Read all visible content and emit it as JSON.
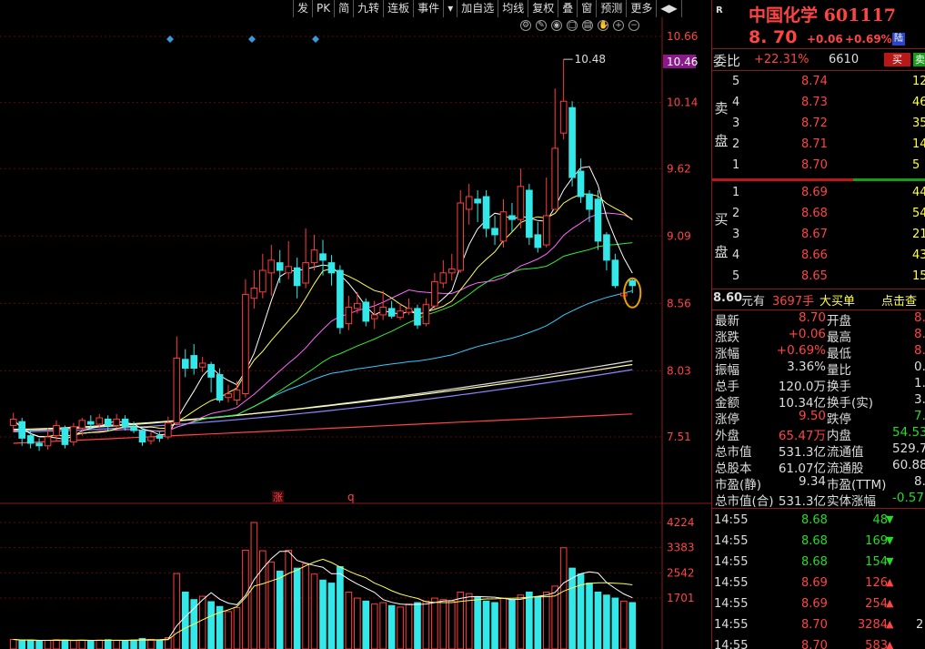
{
  "toolbar": {
    "items": [
      "发",
      "PK",
      "简",
      "九转",
      "连板",
      "事件",
      "▾",
      "加自选",
      "均线",
      "复权",
      "叠",
      "窗",
      "预测",
      "更多",
      "◀▶"
    ]
  },
  "chart_data": {
    "type": "candlestick",
    "price_axis_labels": [
      "10.66",
      "10.46",
      "10.14",
      "9.62",
      "9.09",
      "8.56",
      "8.03",
      "7.51"
    ],
    "current_price_tag": "10.46",
    "high_marker_label": "10.48",
    "volume_axis_labels": [
      "4224",
      "3383",
      "2542",
      "1701"
    ],
    "event_markers": [
      "涨",
      "q"
    ],
    "candles": [
      {
        "o": 7.6,
        "c": 7.65,
        "h": 7.7,
        "l": 7.55
      },
      {
        "o": 7.63,
        "c": 7.5,
        "h": 7.66,
        "l": 7.44
      },
      {
        "o": 7.52,
        "c": 7.46,
        "h": 7.57,
        "l": 7.42
      },
      {
        "o": 7.46,
        "c": 7.44,
        "h": 7.5,
        "l": 7.4
      },
      {
        "o": 7.44,
        "c": 7.51,
        "h": 7.58,
        "l": 7.41
      },
      {
        "o": 7.52,
        "c": 7.6,
        "h": 7.64,
        "l": 7.48
      },
      {
        "o": 7.58,
        "c": 7.45,
        "h": 7.6,
        "l": 7.42
      },
      {
        "o": 7.47,
        "c": 7.59,
        "h": 7.62,
        "l": 7.44
      },
      {
        "o": 7.58,
        "c": 7.64,
        "h": 7.66,
        "l": 7.52
      },
      {
        "o": 7.63,
        "c": 7.61,
        "h": 7.68,
        "l": 7.57
      },
      {
        "o": 7.61,
        "c": 7.66,
        "h": 7.69,
        "l": 7.58
      },
      {
        "o": 7.65,
        "c": 7.6,
        "h": 7.68,
        "l": 7.56
      },
      {
        "o": 7.6,
        "c": 7.65,
        "h": 7.69,
        "l": 7.58
      },
      {
        "o": 7.65,
        "c": 7.59,
        "h": 7.68,
        "l": 7.56
      },
      {
        "o": 7.59,
        "c": 7.56,
        "h": 7.63,
        "l": 7.54
      },
      {
        "o": 7.56,
        "c": 7.47,
        "h": 7.58,
        "l": 7.44
      },
      {
        "o": 7.48,
        "c": 7.51,
        "h": 7.55,
        "l": 7.45
      },
      {
        "o": 7.52,
        "c": 7.5,
        "h": 7.55,
        "l": 7.47
      },
      {
        "o": 7.51,
        "c": 7.62,
        "h": 7.67,
        "l": 7.49
      },
      {
        "o": 7.62,
        "c": 8.13,
        "h": 8.3,
        "l": 7.6
      },
      {
        "o": 8.12,
        "c": 8.05,
        "h": 8.2,
        "l": 7.98
      },
      {
        "o": 8.15,
        "c": 8.05,
        "h": 8.24,
        "l": 8.0
      },
      {
        "o": 8.06,
        "c": 8.09,
        "h": 8.14,
        "l": 8.02
      },
      {
        "o": 8.08,
        "c": 7.98,
        "h": 8.1,
        "l": 7.86
      },
      {
        "o": 8.0,
        "c": 7.8,
        "h": 8.05,
        "l": 7.78
      },
      {
        "o": 7.82,
        "c": 7.85,
        "h": 7.92,
        "l": 7.78
      },
      {
        "o": 7.8,
        "c": 7.88,
        "h": 7.95,
        "l": 7.76
      },
      {
        "o": 7.85,
        "c": 8.63,
        "h": 8.75,
        "l": 7.82
      },
      {
        "o": 8.6,
        "c": 8.68,
        "h": 8.82,
        "l": 8.52
      },
      {
        "o": 8.65,
        "c": 8.82,
        "h": 8.95,
        "l": 8.6
      },
      {
        "o": 8.8,
        "c": 8.9,
        "h": 9.02,
        "l": 8.62
      },
      {
        "o": 8.88,
        "c": 8.82,
        "h": 8.98,
        "l": 8.72
      },
      {
        "o": 8.8,
        "c": 8.85,
        "h": 9.05,
        "l": 8.75
      },
      {
        "o": 8.84,
        "c": 8.7,
        "h": 8.92,
        "l": 8.6
      },
      {
        "o": 8.72,
        "c": 8.88,
        "h": 9.15,
        "l": 8.68
      },
      {
        "o": 8.88,
        "c": 8.98,
        "h": 9.1,
        "l": 8.82
      },
      {
        "o": 8.95,
        "c": 8.9,
        "h": 9.06,
        "l": 8.78
      },
      {
        "o": 8.88,
        "c": 8.8,
        "h": 8.94,
        "l": 8.7
      },
      {
        "o": 8.82,
        "c": 8.37,
        "h": 8.86,
        "l": 8.32
      },
      {
        "o": 8.4,
        "c": 8.53,
        "h": 8.62,
        "l": 8.35
      },
      {
        "o": 8.52,
        "c": 8.56,
        "h": 8.65,
        "l": 8.48
      },
      {
        "o": 8.57,
        "c": 8.42,
        "h": 8.6,
        "l": 8.38
      },
      {
        "o": 8.44,
        "c": 8.47,
        "h": 8.58,
        "l": 8.36
      },
      {
        "o": 8.47,
        "c": 8.53,
        "h": 8.66,
        "l": 8.43
      },
      {
        "o": 8.52,
        "c": 8.46,
        "h": 8.58,
        "l": 8.44
      },
      {
        "o": 8.45,
        "c": 8.5,
        "h": 8.56,
        "l": 8.43
      },
      {
        "o": 8.49,
        "c": 8.52,
        "h": 8.6,
        "l": 8.47
      },
      {
        "o": 8.52,
        "c": 8.39,
        "h": 8.55,
        "l": 8.36
      },
      {
        "o": 8.4,
        "c": 8.55,
        "h": 8.6,
        "l": 8.38
      },
      {
        "o": 8.54,
        "c": 8.73,
        "h": 8.8,
        "l": 8.52
      },
      {
        "o": 8.72,
        "c": 8.8,
        "h": 8.9,
        "l": 8.68
      },
      {
        "o": 8.8,
        "c": 8.83,
        "h": 8.95,
        "l": 8.74
      },
      {
        "o": 8.82,
        "c": 9.35,
        "h": 9.45,
        "l": 8.8
      },
      {
        "o": 9.3,
        "c": 9.4,
        "h": 9.5,
        "l": 9.18
      },
      {
        "o": 9.38,
        "c": 9.35,
        "h": 9.45,
        "l": 9.2
      },
      {
        "o": 9.4,
        "c": 9.15,
        "h": 9.45,
        "l": 9.08
      },
      {
        "o": 9.15,
        "c": 9.1,
        "h": 9.25,
        "l": 9.02
      },
      {
        "o": 9.05,
        "c": 9.28,
        "h": 9.38,
        "l": 9.0
      },
      {
        "o": 9.25,
        "c": 9.22,
        "h": 9.35,
        "l": 9.12
      },
      {
        "o": 9.22,
        "c": 9.48,
        "h": 9.62,
        "l": 9.15
      },
      {
        "o": 9.45,
        "c": 9.08,
        "h": 9.5,
        "l": 9.02
      },
      {
        "o": 9.1,
        "c": 9.0,
        "h": 9.2,
        "l": 8.96
      },
      {
        "o": 9.02,
        "c": 9.25,
        "h": 9.55,
        "l": 9.0
      },
      {
        "o": 9.3,
        "c": 9.78,
        "h": 10.25,
        "l": 9.7
      },
      {
        "o": 9.9,
        "c": 10.15,
        "h": 10.48,
        "l": 9.85
      },
      {
        "o": 10.1,
        "c": 9.55,
        "h": 10.15,
        "l": 9.48
      },
      {
        "o": 9.6,
        "c": 9.4,
        "h": 9.7,
        "l": 9.35
      },
      {
        "o": 9.42,
        "c": 9.3,
        "h": 9.45,
        "l": 9.2
      },
      {
        "o": 9.38,
        "c": 9.05,
        "h": 9.45,
        "l": 8.98
      },
      {
        "o": 9.1,
        "c": 8.9,
        "h": 9.12,
        "l": 8.82
      },
      {
        "o": 8.9,
        "c": 8.7,
        "h": 8.95,
        "l": 8.68
      },
      {
        "o": 8.62,
        "c": 8.64,
        "h": 8.68,
        "l": 8.6
      },
      {
        "o": 8.74,
        "c": 8.7,
        "h": 8.75,
        "l": 8.64
      }
    ],
    "volumes": [
      320,
      280,
      300,
      260,
      290,
      310,
      300,
      280,
      290,
      270,
      300,
      310,
      290,
      280,
      300,
      350,
      320,
      300,
      380,
      2520,
      1900,
      1650,
      1760,
      1580,
      1420,
      1250,
      1380,
      3300,
      4224,
      3280,
      2900,
      2600,
      3300,
      2700,
      2850,
      2500,
      2300,
      2200,
      2750,
      1900,
      1700,
      1600,
      1500,
      1550,
      1450,
      1400,
      1500,
      1550,
      1600,
      1700,
      1650,
      1600,
      1900,
      1850,
      1750,
      1600,
      1550,
      1700,
      1650,
      1800,
      1900,
      1750,
      1900,
      2100,
      3380,
      2700,
      2500,
      2200,
      1900,
      1800,
      1700,
      1600,
      1550
    ]
  },
  "panel": {
    "r_label": "R",
    "stock_name": "中国化学",
    "stock_code": "601117",
    "price": "8. 70",
    "change": "+0.06",
    "change_pct": "+0.69%",
    "exchange_badge": "陆",
    "wb_label": "委比",
    "wb_value": "+22.31%",
    "wb_diff": "6610",
    "buy_btn": "买",
    "sell_btn": "卖",
    "sell_side_label_1": "卖",
    "sell_side_label_2": "盘",
    "buy_side_label_1": "买",
    "buy_side_label_2": "盘",
    "asks": [
      {
        "level": "5",
        "price": "8.74",
        "vol": "12"
      },
      {
        "level": "4",
        "price": "8.73",
        "vol": "46"
      },
      {
        "level": "3",
        "price": "8.72",
        "vol": "35"
      },
      {
        "level": "2",
        "price": "8.71",
        "vol": "14"
      },
      {
        "level": "1",
        "price": "8.70",
        "vol": "5"
      }
    ],
    "bids": [
      {
        "level": "1",
        "price": "8.69",
        "vol": "44"
      },
      {
        "level": "2",
        "price": "8.68",
        "vol": "54"
      },
      {
        "level": "3",
        "price": "8.67",
        "vol": "21"
      },
      {
        "level": "4",
        "price": "8.66",
        "vol": "43"
      },
      {
        "level": "5",
        "price": "8.65",
        "vol": "15"
      }
    ],
    "big_order": {
      "price": "8.60",
      "unit": "元有",
      "vol": "3697手",
      "label": "大买单",
      "link": "点击查"
    },
    "stats": [
      {
        "l1": "最新",
        "v1": "8.70",
        "c1": "red",
        "l2": "开盘",
        "v2": "8.",
        "c2": "red"
      },
      {
        "l1": "涨跌",
        "v1": "+0.06",
        "c1": "red",
        "l2": "最高",
        "v2": "8.",
        "c2": "red"
      },
      {
        "l1": "涨幅",
        "v1": "+0.69%",
        "c1": "red",
        "l2": "最低",
        "v2": "8.",
        "c2": "red"
      },
      {
        "l1": "振幅",
        "v1": "3.36%",
        "c1": "white",
        "l2": "量比",
        "v2": "0.",
        "c2": "white"
      },
      {
        "l1": "总手",
        "v1": "120.0万",
        "c1": "white",
        "l2": "换手",
        "v2": "1.9",
        "c2": "white"
      },
      {
        "l1": "金额",
        "v1": "10.34亿",
        "c1": "white",
        "l2": "换手(实)",
        "v2": "3.5",
        "c2": "white"
      },
      {
        "l1": "涨停",
        "v1": "9.50",
        "c1": "red",
        "l2": "跌停",
        "v2": "7.",
        "c2": "grn"
      },
      {
        "l1": "外盘",
        "v1": "65.47万",
        "c1": "red",
        "l2": "内盘",
        "v2": "54.53",
        "c2": "grn"
      },
      {
        "l1": "总市值",
        "v1": "531.3亿",
        "c1": "white",
        "l2": "流通值",
        "v2": "529.7",
        "c2": "white"
      },
      {
        "l1": "总股本",
        "v1": "61.07亿",
        "c1": "white",
        "l2": "流通股",
        "v2": "60.88",
        "c2": "white"
      },
      {
        "l1": "市盈(静)",
        "v1": "9.34",
        "c1": "white",
        "l2": "市盈(TTM)",
        "v2": "8.",
        "c2": "white"
      },
      {
        "l1": "总市值(合)",
        "v1": "531.3亿",
        "c1": "white",
        "l2": "实体涨幅",
        "v2": "-0.57",
        "c2": "grn"
      }
    ],
    "ticks": [
      {
        "time": "14:55",
        "price": "8.68",
        "price_color": "grn",
        "vol": "48",
        "dir": "down"
      },
      {
        "time": "14:55",
        "price": "8.68",
        "price_color": "grn",
        "vol": "169",
        "dir": "down"
      },
      {
        "time": "14:55",
        "price": "8.68",
        "price_color": "grn",
        "vol": "154",
        "dir": "down"
      },
      {
        "time": "14:55",
        "price": "8.69",
        "price_color": "red",
        "vol": "126",
        "dir": "up"
      },
      {
        "time": "14:55",
        "price": "8.69",
        "price_color": "red",
        "vol": "254",
        "dir": "up"
      },
      {
        "time": "14:55",
        "price": "8.70",
        "price_color": "red",
        "vol": "3284",
        "dir": "up",
        "extra": "2"
      },
      {
        "time": "14:55",
        "price": "8.70",
        "price_color": "red",
        "vol": "583",
        "dir": "up"
      }
    ]
  },
  "colors": {
    "up": "#ff3c3c",
    "down": "#33e8e8",
    "ma5": "#ffffff",
    "ma10": "#ffff55",
    "ma20": "#ff66ff",
    "ma30": "#33ee33",
    "ma60": "#33ccff"
  }
}
